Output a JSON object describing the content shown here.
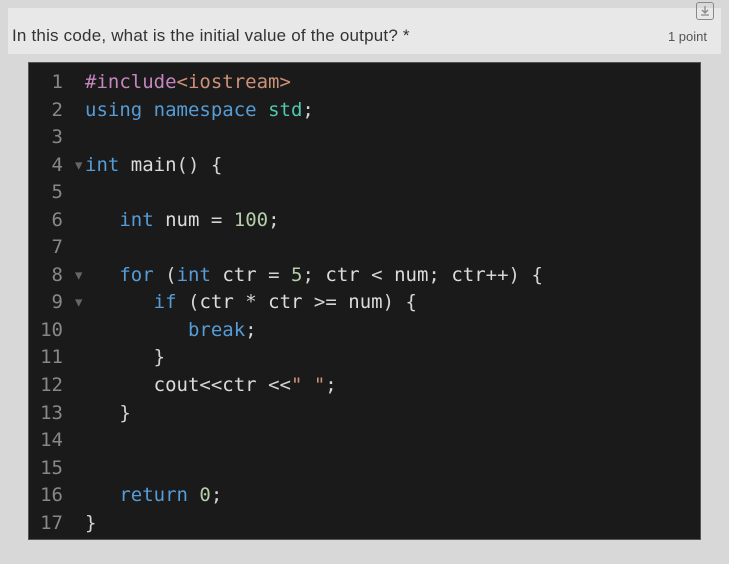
{
  "header": {
    "question": "In this code, what is the initial value of the output? *",
    "points": "1 point"
  },
  "code": {
    "lines": [
      {
        "num": "1",
        "mark": "",
        "html": "<span class='tk-preproc'>#include</span><span class='tk-angle'>&lt;iostream&gt;</span>"
      },
      {
        "num": "2",
        "mark": "",
        "html": "<span class='tk-keyword'>using</span> <span class='tk-keyword'>namespace</span> <span class='tk-namespace'>std</span><span class='tk-punct'>;</span>"
      },
      {
        "num": "3",
        "mark": "",
        "html": ""
      },
      {
        "num": "4",
        "mark": "▾",
        "html": "<span class='tk-type'>int</span> <span class='tk-func'>main</span><span class='tk-punct'>()</span> <span class='tk-punct'>{</span>"
      },
      {
        "num": "5",
        "mark": "",
        "html": ""
      },
      {
        "num": "6",
        "mark": "",
        "html": "   <span class='tk-type'>int</span> <span class='tk-ident'>num</span> <span class='tk-op'>=</span> <span class='tk-number'>100</span><span class='tk-punct'>;</span>"
      },
      {
        "num": "7",
        "mark": "",
        "html": ""
      },
      {
        "num": "8",
        "mark": "▾",
        "html": "   <span class='tk-keyword'>for</span> <span class='tk-punct'>(</span><span class='tk-type'>int</span> <span class='tk-ident'>ctr</span> <span class='tk-op'>=</span> <span class='tk-number'>5</span><span class='tk-punct'>;</span> <span class='tk-ident'>ctr</span> <span class='tk-op'>&lt;</span> <span class='tk-ident'>num</span><span class='tk-punct'>;</span> <span class='tk-ident'>ctr</span><span class='tk-op'>++</span><span class='tk-punct'>)</span> <span class='tk-punct'>{</span>"
      },
      {
        "num": "9",
        "mark": "▾",
        "html": "      <span class='tk-keyword'>if</span> <span class='tk-punct'>(</span><span class='tk-ident'>ctr</span> <span class='tk-op'>*</span> <span class='tk-ident'>ctr</span> <span class='tk-op'>&gt;=</span> <span class='tk-ident'>num</span><span class='tk-punct'>)</span> <span class='tk-punct'>{</span>"
      },
      {
        "num": "10",
        "mark": "",
        "html": "         <span class='tk-keyword'>break</span><span class='tk-punct'>;</span>"
      },
      {
        "num": "11",
        "mark": "",
        "html": "      <span class='tk-punct'>}</span>"
      },
      {
        "num": "12",
        "mark": "",
        "html": "      <span class='tk-ident'>cout</span><span class='tk-op'>&lt;&lt;</span><span class='tk-ident'>ctr</span> <span class='tk-op'>&lt;&lt;</span><span class='tk-string'>\" \"</span><span class='tk-punct'>;</span>"
      },
      {
        "num": "13",
        "mark": "",
        "html": "   <span class='tk-punct'>}</span>"
      },
      {
        "num": "14",
        "mark": "",
        "html": ""
      },
      {
        "num": "15",
        "mark": "",
        "html": ""
      },
      {
        "num": "16",
        "mark": "",
        "html": "   <span class='tk-keyword'>return</span> <span class='tk-number'>0</span><span class='tk-punct'>;</span>"
      },
      {
        "num": "17",
        "mark": "",
        "html": "<span class='tk-punct'>}</span>"
      }
    ]
  }
}
